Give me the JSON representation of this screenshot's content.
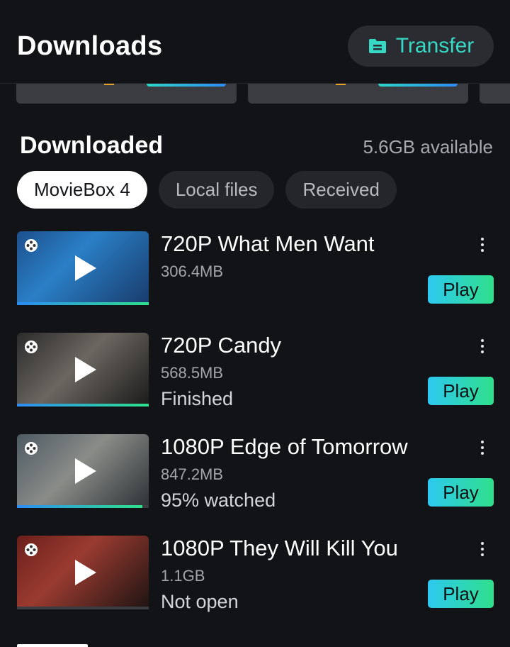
{
  "header": {
    "title": "Downloads",
    "transfer_label": "Transfer",
    "transfer_icon": "folder-transfer-icon",
    "accent_color": "#37d8c4"
  },
  "section": {
    "title": "Downloaded",
    "storage": "5.6GB available"
  },
  "tabs": [
    {
      "label": "MovieBox 4",
      "active": true
    },
    {
      "label": "Local files",
      "active": false
    },
    {
      "label": "Received",
      "active": false
    }
  ],
  "items": [
    {
      "title": "720P What Men Want",
      "size": "306.4MB",
      "status": "",
      "play_label": "Play",
      "progress": 1.0
    },
    {
      "title": "720P Candy",
      "size": "568.5MB",
      "status": "Finished",
      "play_label": "Play",
      "progress": 1.0
    },
    {
      "title": "1080P Edge of Tomorrow",
      "size": "847.2MB",
      "status": "95% watched",
      "play_label": "Play",
      "progress": 0.95
    },
    {
      "title": "1080P They Will Kill You",
      "size": "1.1GB",
      "status": "Not open",
      "play_label": "Play",
      "progress": 0.0
    }
  ],
  "colors": {
    "background": "#121317",
    "play_gradient_start": "#2ec8f0",
    "play_gradient_end": "#2fe08b"
  }
}
